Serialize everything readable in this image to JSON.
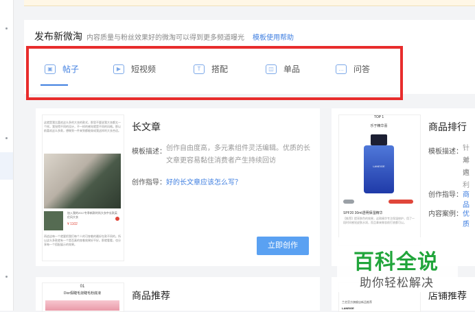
{
  "header": {
    "title": "发布新微淘",
    "subtitle": "内容质量与粉丝效果好的微淘可以得到更多频道曝光",
    "help_link": "模板使用帮助"
  },
  "tabs": [
    {
      "label": "帖子",
      "icon": "image-icon",
      "active": true
    },
    {
      "label": "短视频",
      "icon": "video-icon",
      "active": false
    },
    {
      "label": "搭配",
      "icon": "shirt-icon",
      "active": false
    },
    {
      "label": "单品",
      "icon": "bag-icon",
      "active": false
    },
    {
      "label": "问答",
      "icon": "chat-icon",
      "active": false
    }
  ],
  "cards": {
    "long_article": {
      "title": "长文章",
      "desc_label": "模板描述：",
      "desc_line1": "创作自由度高，多元素组件灵活编辑。优质的长",
      "desc_line2": "文章更容易黏住消费者产生持续回访",
      "guide_label": "创作指导：",
      "guide_link": "好的长文章应该怎么写？",
      "button": "立即创作"
    },
    "ranking": {
      "title": "商品排行",
      "desc_label": "模板描述：",
      "desc_line1": "针对",
      "desc_line2": "单内",
      "desc_line3": "速利",
      "guide_label": "创作指导：",
      "guide_link": "商品",
      "case_label": "内容案例：",
      "case_link": "优质"
    },
    "recommend": {
      "title": "商品推荐"
    },
    "store": {
      "title": "店铺推荐"
    }
  },
  "thumbnails": {
    "article": {
      "lines": "这就是我比喜欢这么多的大衣的款式，那里不要说我大衣都太一个样。我觉得不同的设计，不一样的感觉就是不同的风格。那以前喜欢这么多款，想做到一件来到都能穿成我这样的大衣合适。",
      "item_text": "加入我的2017冬季新款时尚大衣中长款英伦风大衣",
      "price": "¥ 1102",
      "bottom": "再追这每一个就要把我们每个人的可穿着的最好在款不同的。所以这么多款就有一个是否真的穿着效果好不好。那就看看，也分享每一个搭配展示的效果。"
    },
    "ranking": {
      "head": "TOP 1",
      "sub": "乐于精华喜",
      "bottle_label": "LANEIGE",
      "name": "SPF20 30ml透明保湿精华",
      "desc": "【推荐】提亮肤色的效果，这款精华专注保湿修护，用了一段时间感觉皮肤水润，而且拿来做妆前打底都可以。"
    },
    "recommend": {
      "num": "01",
      "title": "Dior假睫毛烧睫毛粉底液"
    },
    "store": {
      "line1": "兰芝官方旗舰店新品推荐",
      "brand": "LANEIGE"
    }
  },
  "watermark": {
    "main": "百科全说",
    "sub": "助你轻松解决"
  }
}
